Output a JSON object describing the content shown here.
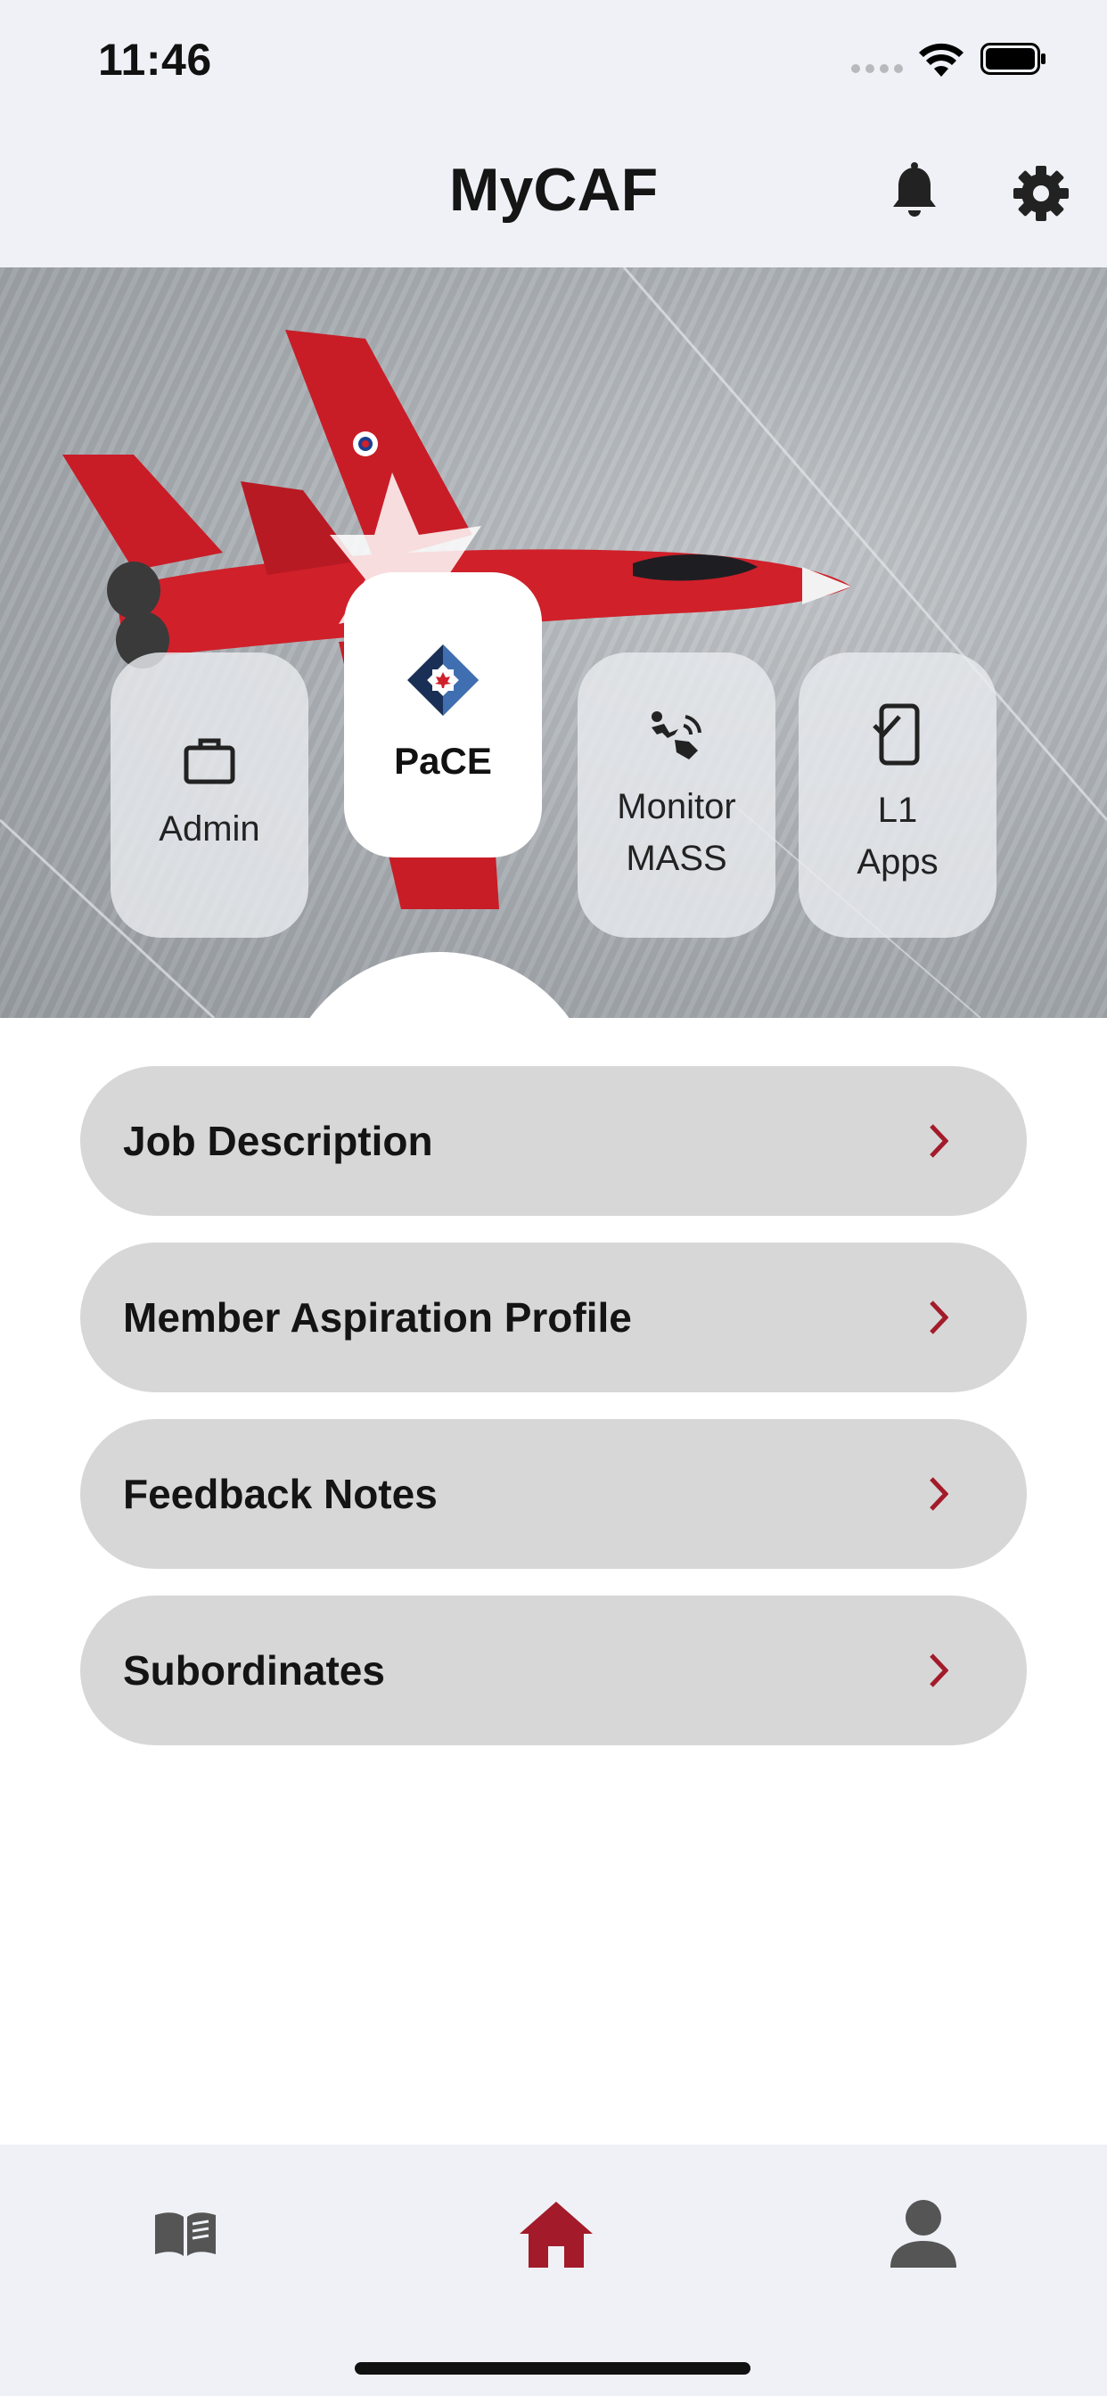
{
  "status_bar": {
    "time": "11:46"
  },
  "header": {
    "title": "MyCAF"
  },
  "tiles": [
    {
      "label": "Admin",
      "icon": "briefcase-icon"
    },
    {
      "label": "PaCE",
      "icon": "pace-logo-icon"
    },
    {
      "label_line1": "Monitor",
      "label_line2": "MASS",
      "icon": "monitor-mass-icon"
    },
    {
      "label_line1": "L1",
      "label_line2": "Apps",
      "icon": "phone-check-icon"
    }
  ],
  "menu": {
    "items": [
      {
        "label": "Job Description"
      },
      {
        "label": "Member Aspiration Profile"
      },
      {
        "label": "Feedback Notes"
      },
      {
        "label": "Subordinates"
      }
    ]
  },
  "bottom_nav": {
    "items": [
      {
        "icon": "book-icon"
      },
      {
        "icon": "home-icon",
        "active": true
      },
      {
        "icon": "person-icon"
      }
    ]
  },
  "colors": {
    "accent": "#a31b2a",
    "background": "#eff1f6",
    "menu_item": "#d7d7d7",
    "icon_dark": "#2b2b2b"
  }
}
